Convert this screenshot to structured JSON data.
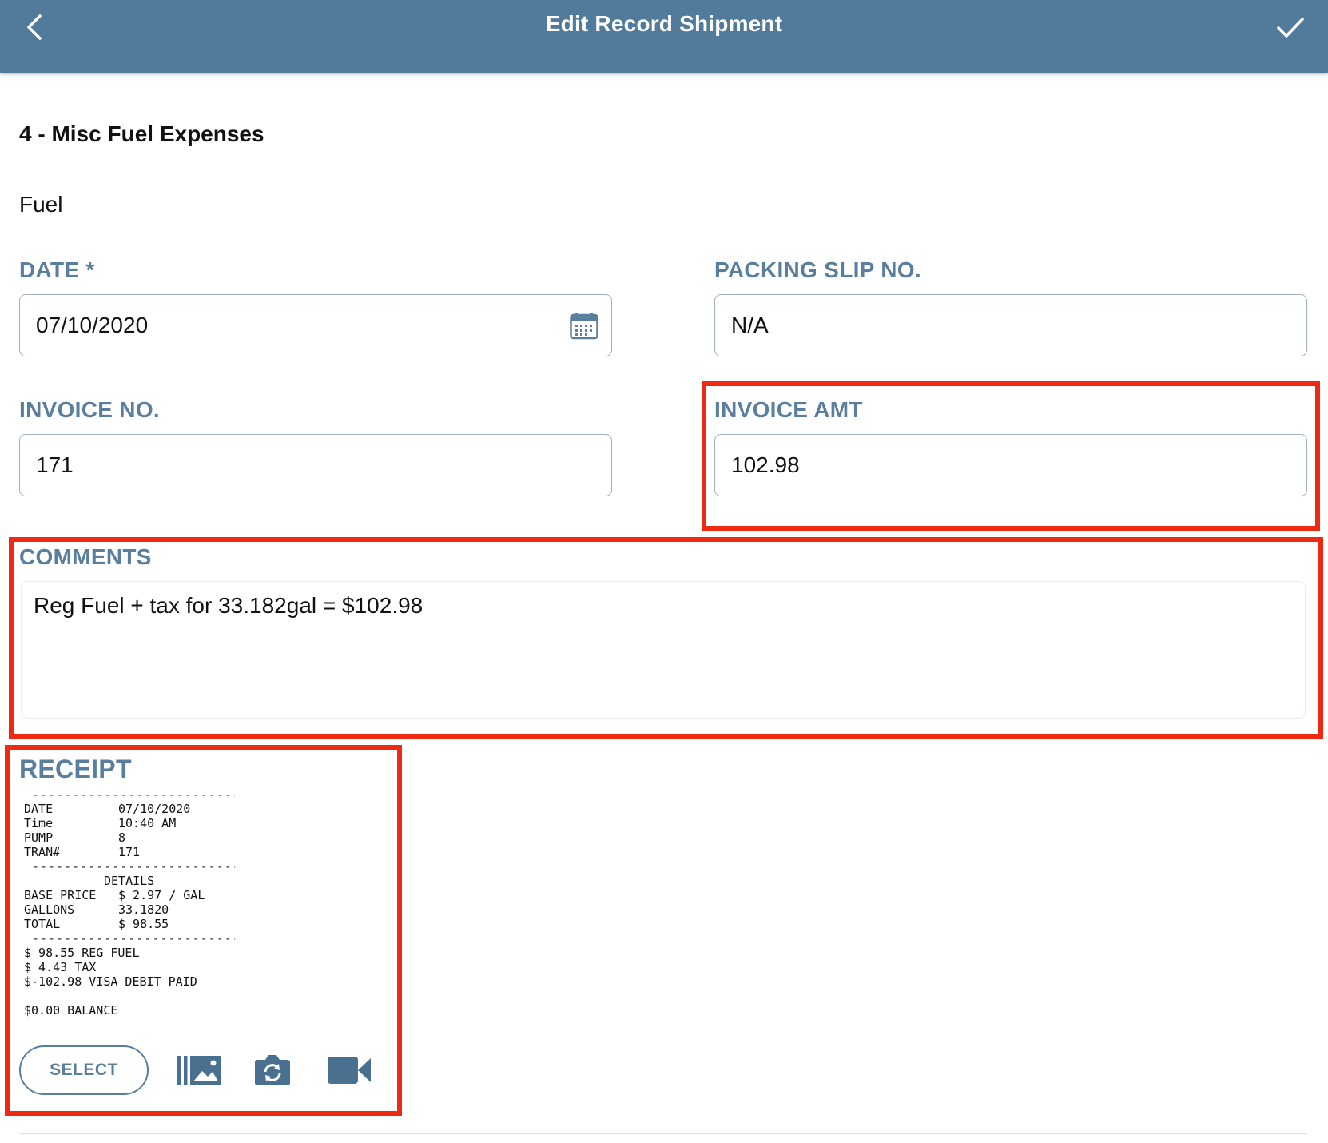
{
  "header": {
    "title": "Edit Record Shipment"
  },
  "section": {
    "title": "4 - Misc Fuel Expenses",
    "subtitle": "Fuel"
  },
  "fields": {
    "date": {
      "label": "DATE *",
      "value": "07/10/2020"
    },
    "packing_slip": {
      "label": "PACKING SLIP NO.",
      "value": "N/A"
    },
    "invoice_no": {
      "label": "INVOICE NO.",
      "value": "171"
    },
    "invoice_amt": {
      "label": "INVOICE AMT",
      "value": "102.98"
    },
    "comments": {
      "label": "COMMENTS",
      "value": "Reg Fuel + tax for 33.182gal = $102.98"
    }
  },
  "receipt": {
    "label": "RECEIPT",
    "select_label": "SELECT",
    "image": {
      "dash_top": "---------------------------",
      "date_key": "DATE",
      "date_val": "07/10/2020",
      "time_key": "Time",
      "time_val": "10:40 AM",
      "pump_key": "PUMP",
      "pump_val": "8",
      "tran_key": "TRAN#",
      "tran_val": "171",
      "dash_mid": "---------------------------",
      "details": "DETAILS",
      "base_key": "BASE PRICE",
      "base_val": "$ 2.97 / GAL",
      "gallons_key": "GALLONS",
      "gallons_val": "33.1820",
      "total_key": "TOTAL",
      "total_val": "$ 98.55",
      "dash_bottom": "---------------------------",
      "line1": "$ 98.55 REG FUEL",
      "line2": "$ 4.43 TAX",
      "line3": "$-102.98 VISA DEBIT PAID",
      "line4": "$0.00 BALANCE"
    }
  },
  "icons": {
    "back": "chevron-left-icon",
    "save": "checkmark-icon",
    "calendar": "calendar-icon",
    "gallery": "image-gallery-icon",
    "camera": "camera-switch-icon",
    "video": "video-camera-icon"
  },
  "colors": {
    "header_bg": "#527a9a",
    "label": "#5a7f9e",
    "highlight": "#ee2a12"
  }
}
